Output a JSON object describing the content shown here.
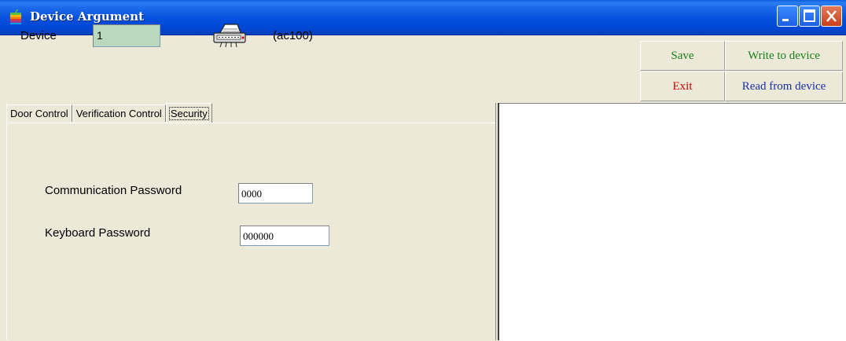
{
  "window": {
    "title": "Device Argument",
    "icon": "apple-logo-icon",
    "controls": [
      "minimize-icon",
      "maximize-icon",
      "close-icon"
    ]
  },
  "header": {
    "device_label": "Device",
    "device_value": "1",
    "device_icon": "device-terminal-icon",
    "model": "(ac100)"
  },
  "buttons": {
    "save": "Save",
    "write": "Write to device",
    "exit": "Exit",
    "read": "Read from device"
  },
  "tabs": [
    {
      "label": "Door Control",
      "active": false
    },
    {
      "label": "Verification Control",
      "active": false
    },
    {
      "label": "Security",
      "active": true
    }
  ],
  "security": {
    "comm_password_label": "Communication Password",
    "comm_password_value": "0000",
    "keyboard_password_label": "Keyboard Password",
    "keyboard_password_value": "000000"
  },
  "colors": {
    "titlebar": "#0550DD",
    "device_input_bg": "#B9D8BD",
    "save_write_text": "#1A7F1A",
    "exit_text": "#D00000",
    "read_text": "#1730A8"
  }
}
